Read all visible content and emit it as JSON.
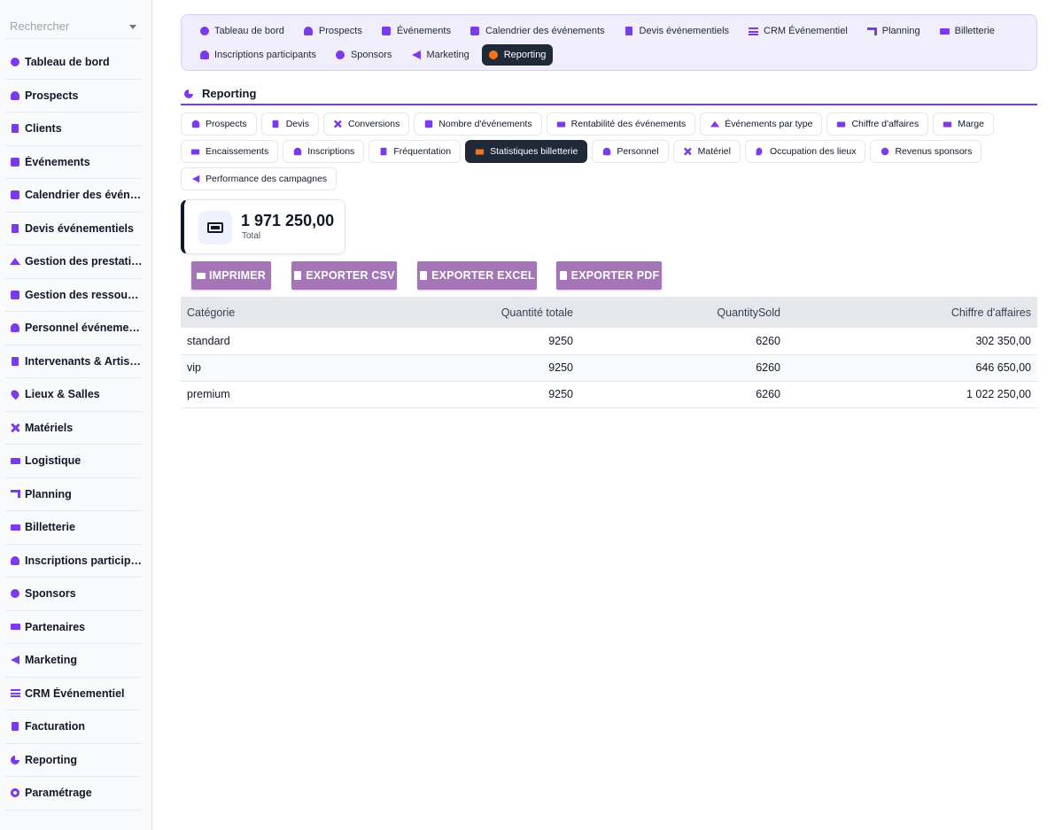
{
  "search": {
    "placeholder": "Rechercher"
  },
  "sidebar": {
    "items": [
      {
        "label": "Tableau de bord",
        "icon": "dashboard-icon"
      },
      {
        "label": "Prospects",
        "icon": "user-plus-icon"
      },
      {
        "label": "Clients",
        "icon": "building-icon"
      },
      {
        "label": "Événements",
        "icon": "calendar-check-icon"
      },
      {
        "label": "Calendrier des évén…",
        "icon": "calendar-icon"
      },
      {
        "label": "Devis événementiels",
        "icon": "file-invoice-icon"
      },
      {
        "label": "Gestion des prestati…",
        "icon": "bell-concierge-icon"
      },
      {
        "label": "Gestion des ressour…",
        "icon": "cubes-icon"
      },
      {
        "label": "Personnel événemen…",
        "icon": "user-tie-icon"
      },
      {
        "label": "Intervenants & Artistes",
        "icon": "microphone-icon"
      },
      {
        "label": "Lieux & Salles",
        "icon": "location-pin-icon"
      },
      {
        "label": "Matériels",
        "icon": "tools-icon"
      },
      {
        "label": "Logistique",
        "icon": "truck-icon"
      },
      {
        "label": "Planning",
        "icon": "sitemap-icon"
      },
      {
        "label": "Billetterie",
        "icon": "ticket-icon"
      },
      {
        "label": "Inscriptions particip…",
        "icon": "user-check-icon"
      },
      {
        "label": "Sponsors",
        "icon": "award-icon"
      },
      {
        "label": "Partenaires",
        "icon": "handshake-icon"
      },
      {
        "label": "Marketing",
        "icon": "megaphone-icon"
      },
      {
        "label": "CRM Événementiel",
        "icon": "list-icon"
      },
      {
        "label": "Facturation",
        "icon": "file-invoice-dollar-icon"
      },
      {
        "label": "Reporting",
        "icon": "pie-chart-icon"
      },
      {
        "label": "Paramétrage",
        "icon": "gear-icon"
      }
    ]
  },
  "topnav": {
    "row1": [
      {
        "label": "Tableau de bord",
        "icon": "dashboard-icon"
      },
      {
        "label": "Prospects",
        "icon": "user-plus-icon"
      },
      {
        "label": "Événements",
        "icon": "calendar-check-icon"
      },
      {
        "label": "Calendrier des événements",
        "icon": "calendar-icon"
      },
      {
        "label": "Devis événementiels",
        "icon": "file-invoice-icon"
      },
      {
        "label": "CRM Événementiel",
        "icon": "list-icon"
      },
      {
        "label": "Planning",
        "icon": "sitemap-icon"
      },
      {
        "label": "Billetterie",
        "icon": "ticket-icon"
      }
    ],
    "row2": [
      {
        "label": "Inscriptions participants",
        "icon": "user-check-icon"
      },
      {
        "label": "Sponsors",
        "icon": "award-icon"
      },
      {
        "label": "Marketing",
        "icon": "megaphone-icon"
      },
      {
        "label": "Reporting",
        "icon": "pie-chart-icon",
        "active": true
      }
    ]
  },
  "section": {
    "title": "Reporting"
  },
  "tabs": [
    {
      "label": "Prospects",
      "icon": "user-plus-icon"
    },
    {
      "label": "Devis",
      "icon": "file-icon"
    },
    {
      "label": "Conversions",
      "icon": "percent-icon"
    },
    {
      "label": "Nombre d'événements",
      "icon": "calendar-check-icon"
    },
    {
      "label": "Rentabilité des événements",
      "icon": "chart-line-icon"
    },
    {
      "label": "Événements par type",
      "icon": "shapes-icon"
    },
    {
      "label": "Chiffre d'affaires",
      "icon": "coins-icon"
    },
    {
      "label": "Marge",
      "icon": "scale-icon"
    },
    {
      "label": "Encaissements",
      "icon": "money-bill-icon"
    },
    {
      "label": "Inscriptions",
      "icon": "user-check-icon"
    },
    {
      "label": "Fréquentation",
      "icon": "clipboard-check-icon"
    },
    {
      "label": "Statistiques billetterie",
      "icon": "ticket-icon",
      "active": true
    },
    {
      "label": "Personnel",
      "icon": "user-icon"
    },
    {
      "label": "Matériel",
      "icon": "tools-icon"
    },
    {
      "label": "Occupation des lieux",
      "icon": "location-pin-icon"
    },
    {
      "label": "Revenus sponsors",
      "icon": "award-icon"
    },
    {
      "label": "Performance des campagnes",
      "icon": "megaphone-icon"
    }
  ],
  "kpi": {
    "value": "1 971 250,00",
    "label": "Total",
    "icon": "ticket-icon"
  },
  "buttons": {
    "print": "IMPRIMER",
    "csv": "EXPORTER CSV",
    "excel": "EXPORTER EXCEL",
    "pdf": "EXPORTER PDF"
  },
  "table": {
    "headers": [
      "Catégorie",
      "Quantité totale",
      "QuantitySold",
      "Chiffre d'affaires"
    ],
    "rows": [
      [
        "standard",
        "9250",
        "6260",
        "302 350,00"
      ],
      [
        "vip",
        "9250",
        "6260",
        "646 650,00"
      ],
      [
        "premium",
        "9250",
        "6260",
        "1 022 250,00"
      ]
    ]
  },
  "colors": {
    "accent": "#7c3aed",
    "active_bg": "#1f2937",
    "active_icon": "#f97316",
    "button_bg": "#a476b8"
  }
}
